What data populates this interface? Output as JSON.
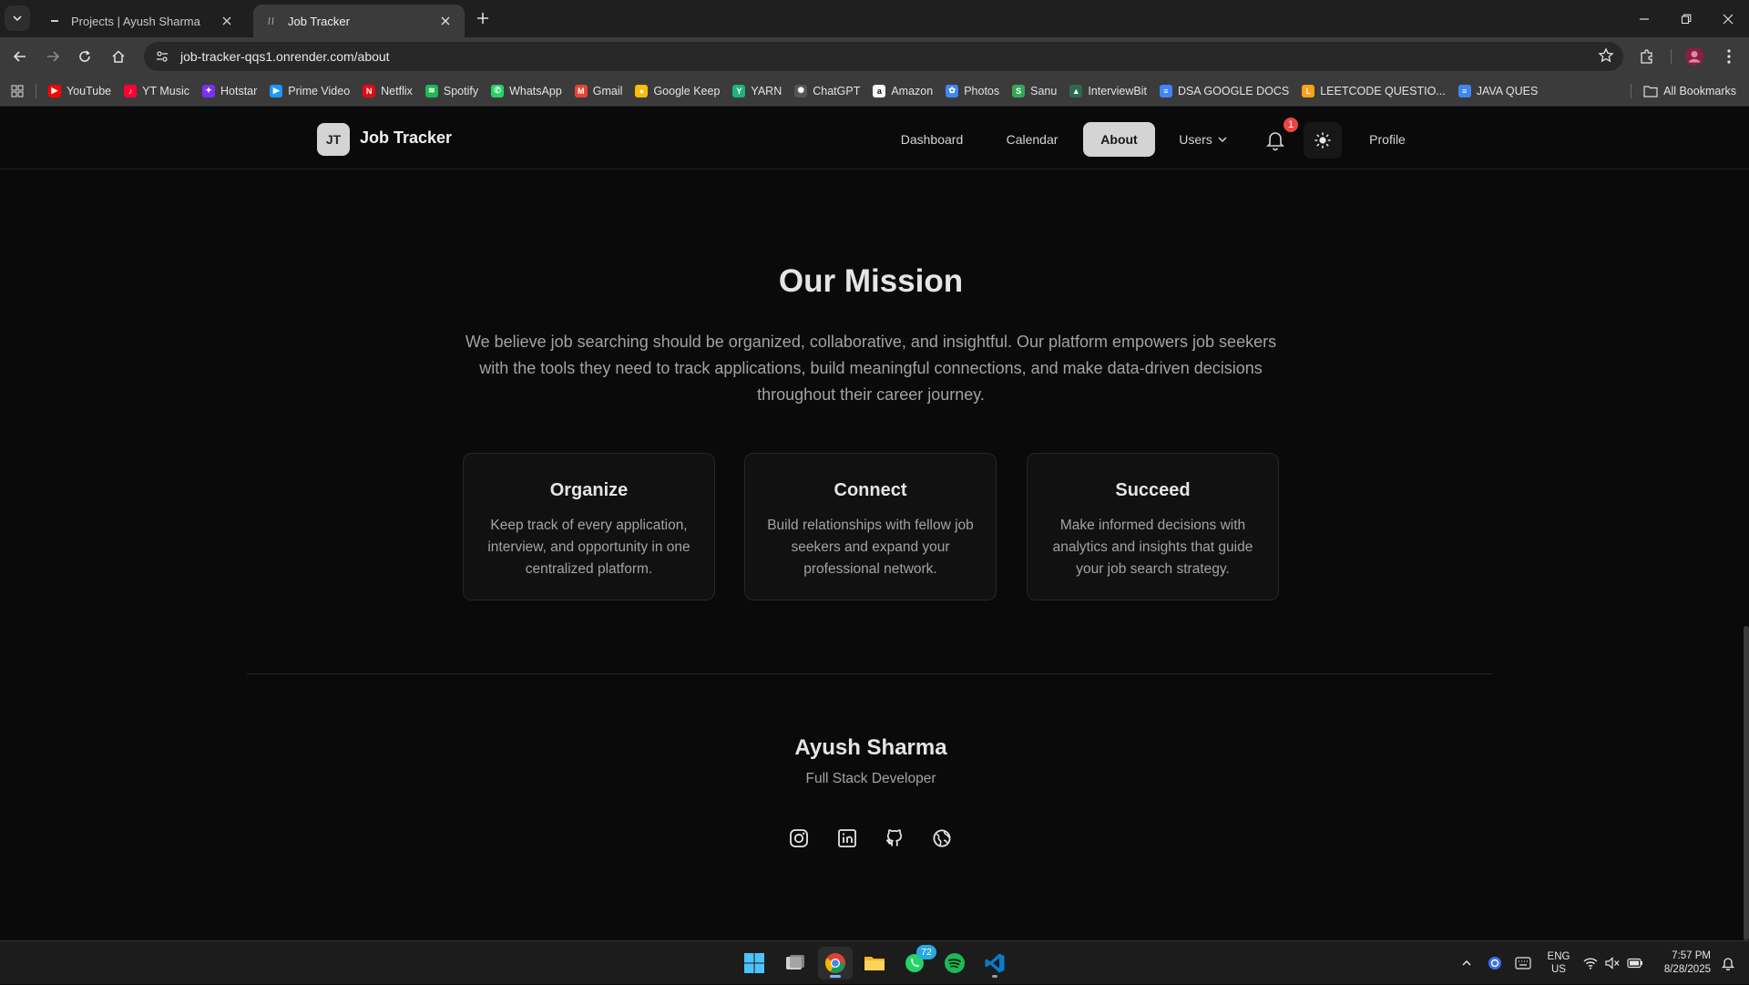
{
  "browser": {
    "tabs": [
      {
        "title": "Projects | Ayush Sharma",
        "active": false
      },
      {
        "title": "Job Tracker",
        "active": true
      }
    ],
    "url": "job-tracker-qqs1.onrender.com/about",
    "bookmarks": [
      {
        "label": "YouTube",
        "color": "#ff0000",
        "glyph": "▶"
      },
      {
        "label": "YT Music",
        "color": "#ff0033",
        "glyph": "♪"
      },
      {
        "label": "Hotstar",
        "color": "#7b2ff7",
        "glyph": "✦"
      },
      {
        "label": "Prime Video",
        "color": "#1a98ff",
        "glyph": "▶"
      },
      {
        "label": "Netflix",
        "color": "#e50914",
        "glyph": "N"
      },
      {
        "label": "Spotify",
        "color": "#1db954",
        "glyph": "≋"
      },
      {
        "label": "WhatsApp",
        "color": "#25d366",
        "glyph": "✆"
      },
      {
        "label": "Gmail",
        "color": "#ea4335",
        "glyph": "M"
      },
      {
        "label": "Google Keep",
        "color": "#fbbc04",
        "glyph": "●"
      },
      {
        "label": "YARN",
        "color": "#1fb37a",
        "glyph": "Y"
      },
      {
        "label": "ChatGPT",
        "color": "#555555",
        "glyph": "✺"
      },
      {
        "label": "Amazon",
        "color": "#f5f5f5",
        "glyph": "a"
      },
      {
        "label": "Photos",
        "color": "#4285f4",
        "glyph": "✿"
      },
      {
        "label": "Sanu",
        "color": "#34a853",
        "glyph": "S"
      },
      {
        "label": "InterviewBit",
        "color": "#2d6a4f",
        "glyph": "▲"
      },
      {
        "label": "DSA GOOGLE DOCS",
        "color": "#4285f4",
        "glyph": "≡"
      },
      {
        "label": "LEETCODE QUESTIO...",
        "color": "#ffa116",
        "glyph": "L"
      },
      {
        "label": "JAVA QUES",
        "color": "#4285f4",
        "glyph": "≡"
      }
    ],
    "all_bookmarks": "All Bookmarks"
  },
  "navbar": {
    "logo_initials": "JT",
    "brand": "Job Tracker",
    "links": {
      "dashboard": "Dashboard",
      "calendar": "Calendar",
      "about": "About",
      "users": "Users",
      "profile": "Profile"
    },
    "active_link": "About",
    "notification_count": "1"
  },
  "mission": {
    "title": "Our Mission",
    "text": "We believe job searching should be organized, collaborative, and insightful. Our platform empowers job seekers with the tools they need to track applications, build meaningful connections, and make data-driven decisions throughout their career journey.",
    "cards": [
      {
        "title": "Organize",
        "text": "Keep track of every application, interview, and opportunity in one centralized platform."
      },
      {
        "title": "Connect",
        "text": "Build relationships with fellow job seekers and expand your professional network."
      },
      {
        "title": "Succeed",
        "text": "Make informed decisions with analytics and insights that guide your job search strategy."
      }
    ]
  },
  "footer": {
    "author": "Ayush Sharma",
    "role": "Full Stack Developer",
    "social_icons": [
      "instagram-icon",
      "linkedin-icon",
      "github-icon",
      "globe-icon"
    ]
  },
  "taskbar": {
    "whatsapp_badge": "72",
    "lang_line1": "ENG",
    "lang_line2": "US",
    "time": "7:57 PM",
    "date": "8/28/2025"
  }
}
